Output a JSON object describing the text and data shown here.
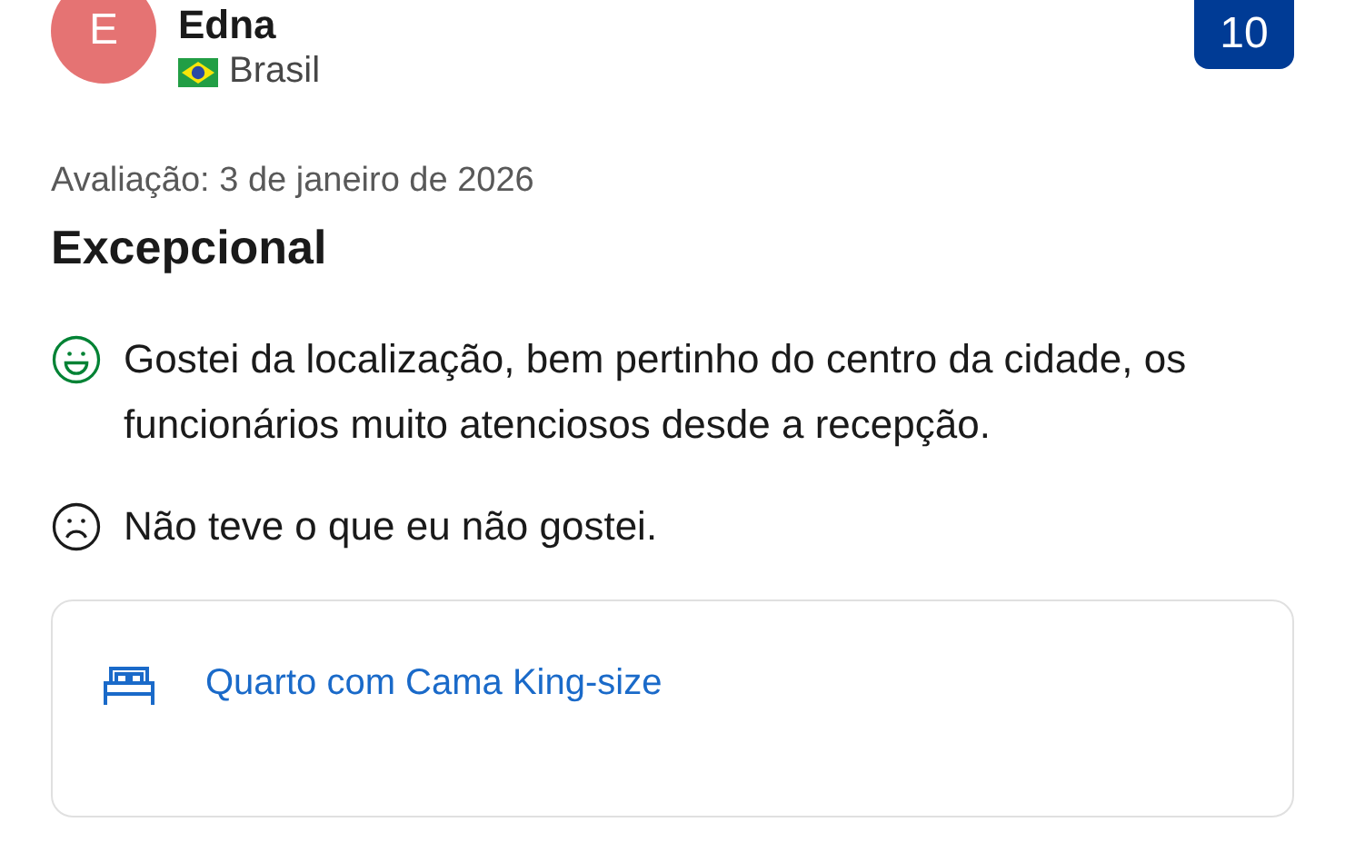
{
  "reviewer": {
    "initial": "E",
    "name": "Edna",
    "country": "Brasil"
  },
  "score": "10",
  "review_date": "Avaliação: 3 de janeiro de 2026",
  "title": "Excepcional",
  "comments": [
    {
      "kind": "liked",
      "text": "Gostei da localização, bem pertinho do centro da cidade, os funcionários muito atenciosos desde a recepção."
    },
    {
      "kind": "disliked",
      "text": "Não teve o que eu não gostei."
    }
  ],
  "room": {
    "name": "Quarto com Cama King-size"
  }
}
